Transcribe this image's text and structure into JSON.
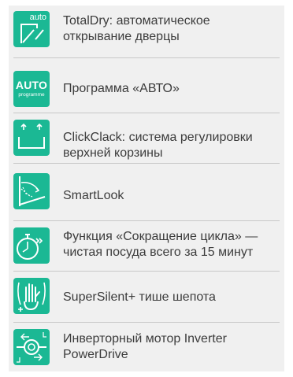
{
  "colors": {
    "icon_tile": "#1bb894",
    "panel_background": "#f0f0f0",
    "text": "#3c3c3c",
    "divider": "#c8c8c8"
  },
  "features": [
    {
      "icon": "auto-door-open-icon",
      "icon_text": "auto",
      "label": "TotalDry: автоматическое\nоткрывание дверцы"
    },
    {
      "icon": "auto-programme-icon",
      "icon_text": "AUTO",
      "icon_subtext": "programme",
      "label": "Программа «АВТО»"
    },
    {
      "icon": "basket-height-adjust-icon",
      "label": "ClickClack: система регулировки\nверхней корзины"
    },
    {
      "icon": "smartlook-projection-icon",
      "label": "SmartLook"
    },
    {
      "icon": "timer-fast-forward-icon",
      "label": "Функция «Сокращение цикла» —\nчистая посуда всего за 15 минут"
    },
    {
      "icon": "silent-hand-icon",
      "label": "SuperSilent+ тише шепота"
    },
    {
      "icon": "inverter-motor-icon",
      "label": "Инверторный мотор Inverter\nPowerDrive"
    }
  ]
}
